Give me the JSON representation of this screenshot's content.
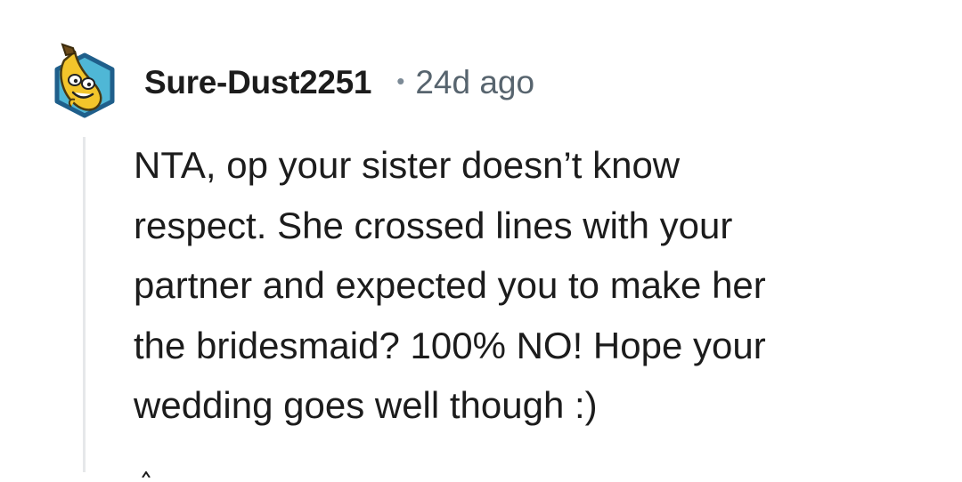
{
  "comment": {
    "username": "Sure-Dust2251",
    "separator": "•",
    "timestamp": "24d ago",
    "avatar_icon": "banana-avatar-icon",
    "body_lines": [
      "NTA, op your sister doesn’t know",
      "respect. She crossed lines with your",
      "partner and expected you to make her",
      "the bridesmaid? 100% NO! Hope your",
      "wedding goes well though :)"
    ]
  },
  "colors": {
    "text": "#1c1c1c",
    "meta": "#57646e",
    "thread_line": "#e6e8ea",
    "avatar_ring": "#1f5f8b",
    "avatar_fill": "#4fb7d6",
    "banana": "#f3c52b"
  }
}
